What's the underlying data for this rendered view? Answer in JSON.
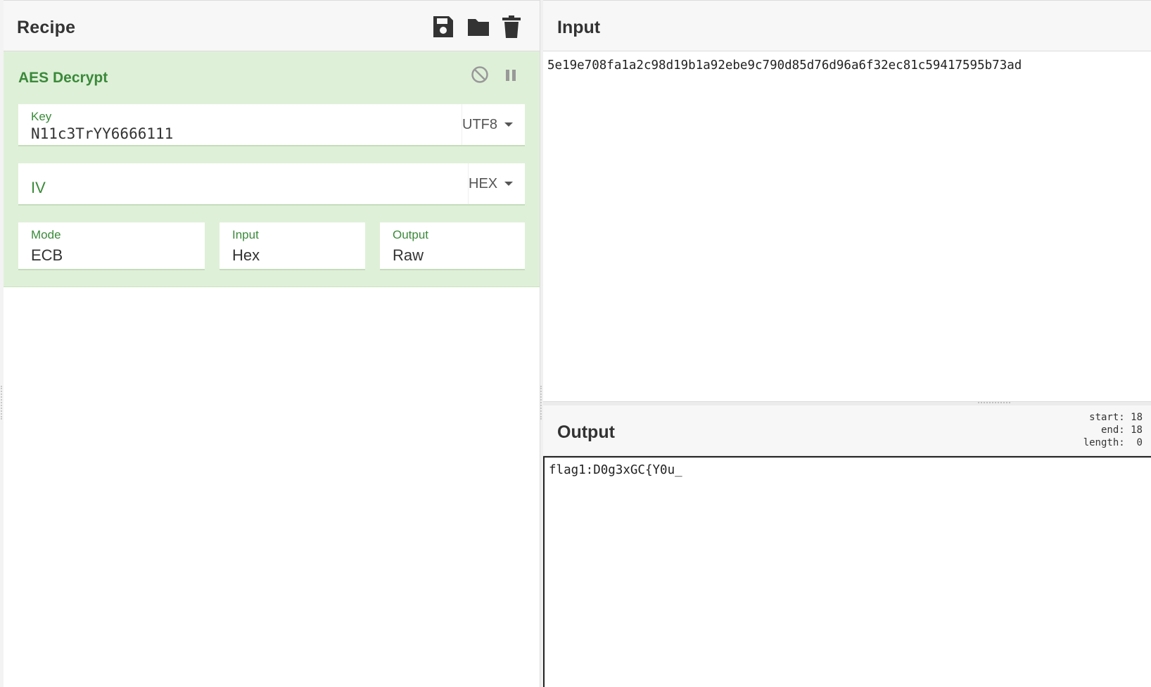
{
  "recipe": {
    "title": "Recipe",
    "icons": [
      "save-icon",
      "folder-icon",
      "trash-icon"
    ],
    "operation": {
      "title": "AES Decrypt",
      "key": {
        "label": "Key",
        "value": "N11c3TrYY6666111",
        "encoding": "UTF8"
      },
      "iv": {
        "label": "IV",
        "value": "",
        "encoding": "HEX"
      },
      "mode": {
        "label": "Mode",
        "value": "ECB"
      },
      "input": {
        "label": "Input",
        "value": "Hex"
      },
      "output": {
        "label": "Output",
        "value": "Raw"
      },
      "accent_color": "#3a8a3a",
      "background_color": "#dff0d8"
    }
  },
  "input": {
    "title": "Input",
    "text": "5e19e708fa1a2c98d19b1a92ebe9c790d85d76d96a6f32ec81c59417595b73ad"
  },
  "output": {
    "title": "Output",
    "stats": {
      "start": "start: 18",
      "end": "end: 18",
      "length": "length:  0"
    },
    "text": "flag1:D0g3xGC{Y0u_"
  }
}
